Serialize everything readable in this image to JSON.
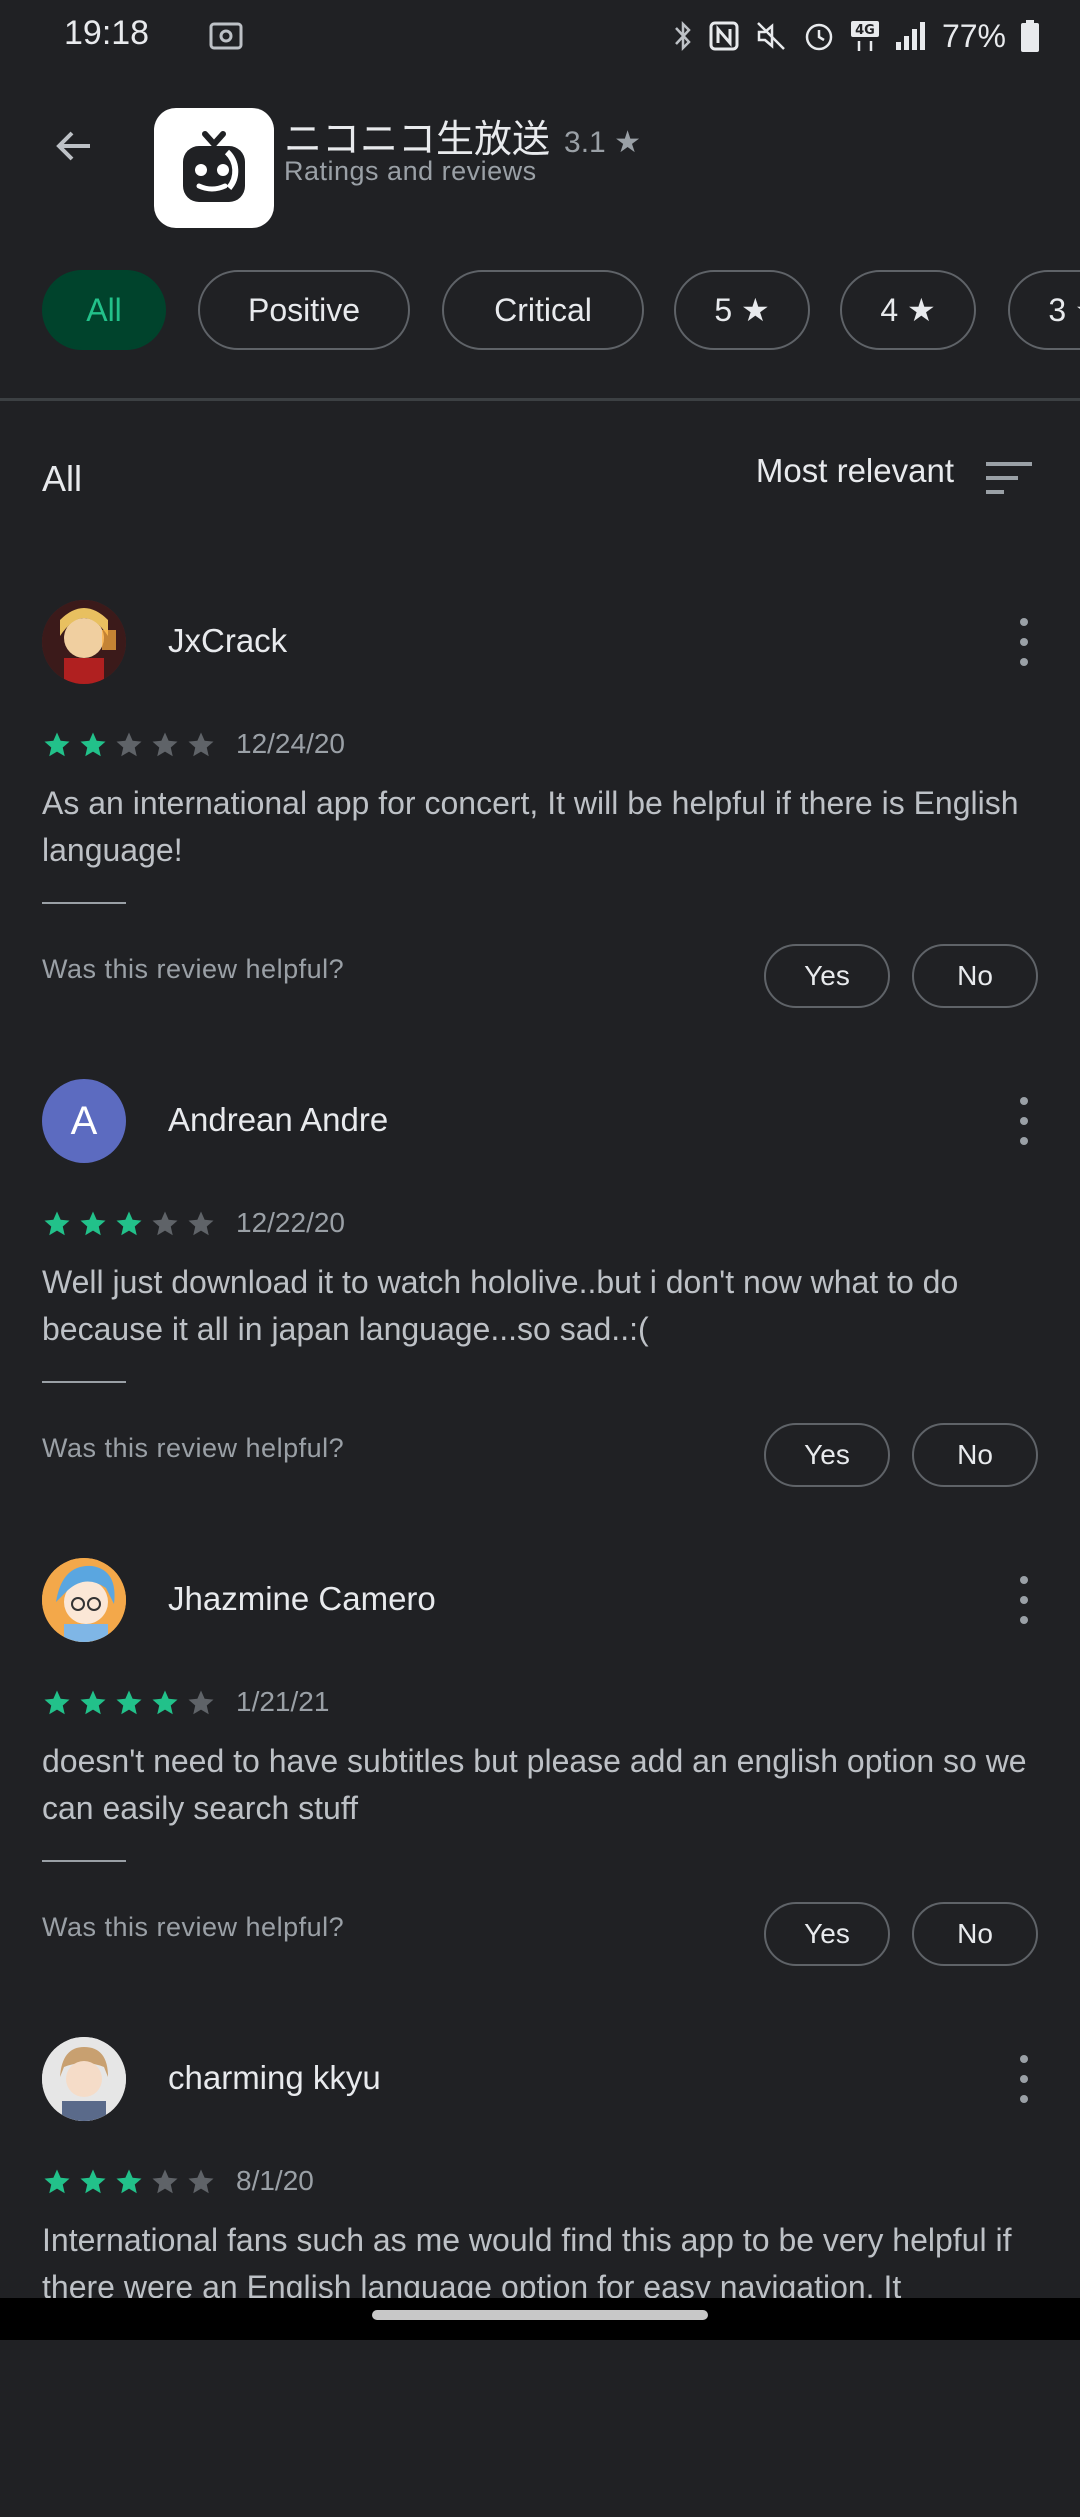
{
  "status_bar": {
    "time": "19:18",
    "battery_percent": "77%",
    "icons": [
      "cast-icon",
      "bluetooth-icon",
      "nfc-icon",
      "mute-icon",
      "alarm-icon",
      "4g-icon",
      "signal-icon",
      "battery-icon"
    ]
  },
  "header": {
    "app_name": "ニコニコ生放送",
    "rating": "3.1",
    "subtitle": "Ratings and reviews"
  },
  "filters": [
    {
      "label": "All",
      "active": true
    },
    {
      "label": "Positive",
      "active": false
    },
    {
      "label": "Critical",
      "active": false
    },
    {
      "label": "5",
      "active": false
    },
    {
      "label": "4",
      "active": false
    },
    {
      "label": "3",
      "active": false
    }
  ],
  "section": {
    "title": "All",
    "sort_label": "Most relevant"
  },
  "helpful": {
    "question": "Was this review helpful?",
    "yes": "Yes",
    "no": "No"
  },
  "reviews": [
    {
      "name": "JxCrack",
      "stars": 2,
      "date": "12/24/20",
      "text": "As an international app for concert, It will be helpful if there is English language!",
      "avatar_initial": ""
    },
    {
      "name": "Andrean Andre",
      "stars": 3,
      "date": "12/22/20",
      "text": "Well just download it to watch hololive..but i don't now what to do because it all in japan language...so sad..:(",
      "avatar_initial": "A"
    },
    {
      "name": "Jhazmine Camero",
      "stars": 4,
      "date": "1/21/21",
      "text": "doesn't need to have subtitles but please add an english option so we can easily search stuff",
      "avatar_initial": ""
    },
    {
      "name": "charming kkyu",
      "stars": 3,
      "date": "8/1/20",
      "text": "International fans such as me would find this app to be very helpful if there were an English language option for easy navigation. It",
      "avatar_initial": ""
    }
  ],
  "colors": {
    "background": "#202124",
    "accent_green": "#22c18a",
    "chip_active_bg": "#00432c",
    "star_empty": "#5f6368",
    "avatar_a": "#5c6bc0"
  }
}
